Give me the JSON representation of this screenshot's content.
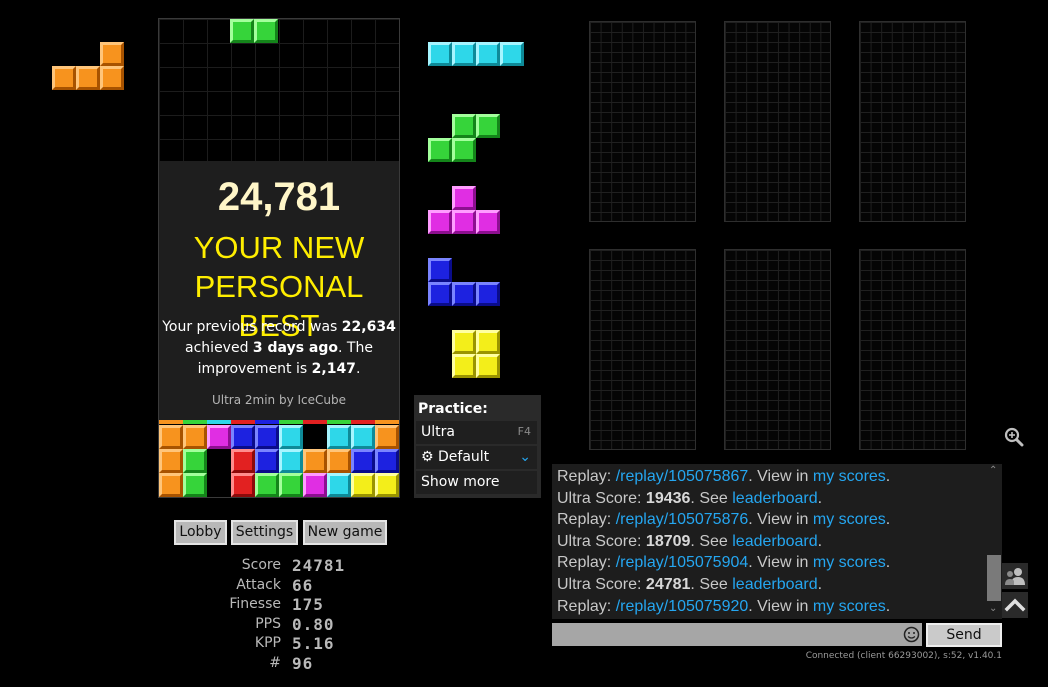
{
  "result": {
    "score": "24,781",
    "headline_line1": "YOUR NEW",
    "headline_line2": "PERSONAL BEST",
    "prev_prefix": "Your previous record was ",
    "prev_value": "22,634",
    "achieved_prefix": "achieved ",
    "achieved_value": "3 days ago",
    "achieved_suffix": ". The",
    "improvement_prefix": "improvement is ",
    "improvement_value": "2,147",
    "improvement_suffix": ".",
    "mode": "Ultra 2min by IceCube"
  },
  "buttons": {
    "lobby": "Lobby",
    "settings": "Settings",
    "new_game": "New game"
  },
  "stats": [
    {
      "label": "Score",
      "value": "24781"
    },
    {
      "label": "Attack",
      "value": "66"
    },
    {
      "label": "Finesse",
      "value": "175"
    },
    {
      "label": "PPS",
      "value": "0.80"
    },
    {
      "label": "KPP",
      "value": "5.16"
    },
    {
      "label": "#",
      "value": "96"
    }
  ],
  "practice": {
    "title": "Practice:",
    "mode": "Ultra",
    "mode_key": "F4",
    "preset": "Default",
    "show_more": "Show more"
  },
  "hold_piece": "L",
  "queue": [
    "I",
    "S",
    "T",
    "J",
    "O"
  ],
  "chat": {
    "lines": [
      {
        "pre": "Replay: ",
        "link": "/replay/105075867",
        "mid": ". View in ",
        "link2": "my scores",
        "post": "."
      },
      {
        "pre": "Ultra Score: ",
        "bold": "19436",
        "mid": ". See ",
        "link2": "leaderboard",
        "post": "."
      },
      {
        "pre": "Replay: ",
        "link": "/replay/105075876",
        "mid": ". View in ",
        "link2": "my scores",
        "post": "."
      },
      {
        "pre": "Ultra Score: ",
        "bold": "18709",
        "mid": ". See ",
        "link2": "leaderboard",
        "post": "."
      },
      {
        "pre": "Replay: ",
        "link": "/replay/105075904",
        "mid": ". View in ",
        "link2": "my scores",
        "post": "."
      },
      {
        "pre": "Ultra Score: ",
        "bold": "24781",
        "mid": ". See ",
        "link2": "leaderboard",
        "post": "."
      },
      {
        "pre": "Replay: ",
        "link": "/replay/105075920",
        "mid": ". View in ",
        "link2": "my scores",
        "post": "."
      }
    ],
    "input_placeholder": "",
    "send": "Send",
    "status": "Connected (client 66293002), s:52, v1.40.1"
  },
  "colors": {
    "headline": "#ffee00",
    "link": "#25a6f0"
  }
}
